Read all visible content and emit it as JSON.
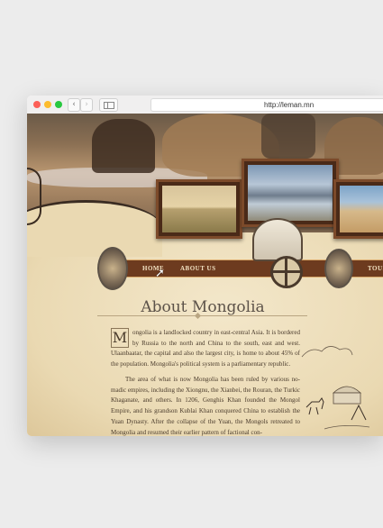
{
  "browser": {
    "url": "http://leman.mn",
    "back_icon": "‹",
    "forward_icon": "›"
  },
  "nav": {
    "items": [
      "HOME",
      "ABOUT US",
      "TOUR"
    ]
  },
  "article": {
    "title": "About Mongolia",
    "dropcap": "M",
    "paragraph1": "ongolia is a landlocked country in east-central Asia. It is bordered by Russia to the north and China to the south, east and west. Ulaanbaatar, the capital and also the largest city, is home to about 45% of the population. Mongolia's political system is a parliamentary republic.",
    "paragraph2": "The area of what is now Mongolia has been ruled by various no-madic empires, including the Xiongnu, the Xianbei, the Rouran, the Turkic Khaganate, and others. In 1206, Genghis Khan founded the Mongol Empire, and his grandson Kublai Khan conquered China to establish the Yuan Dynasty. After the collapse of the Yuan, the Mongols retreated to Mongolia and resumed their earlier pattern of factional con-"
  },
  "colors": {
    "nav_bar": "#6d3b1f",
    "parchment": "#efe2c2",
    "title": "#5c5249"
  }
}
